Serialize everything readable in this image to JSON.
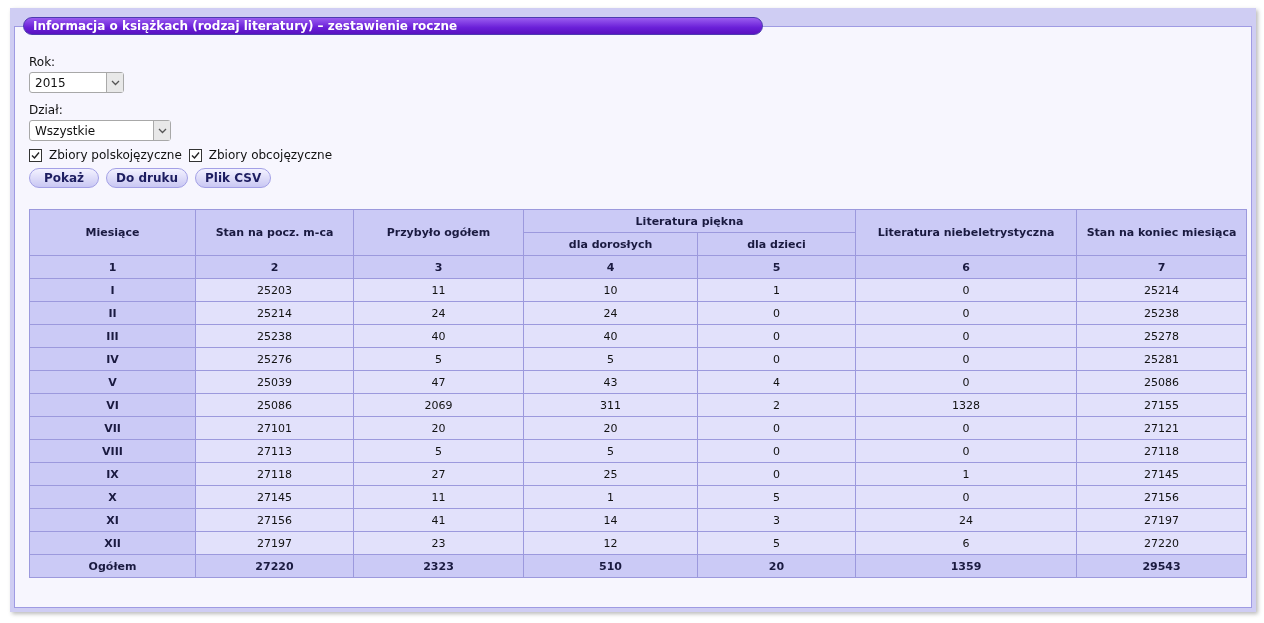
{
  "panel": {
    "title": "Informacja o książkach (rodzaj literatury) – zestawienie roczne"
  },
  "filters": {
    "year": {
      "label": "Rok:",
      "value": "2015"
    },
    "department": {
      "label": "Dział:",
      "value": "Wszystkie"
    }
  },
  "checkboxes": [
    {
      "label": "Zbiory polskojęzyczne",
      "checked": true
    },
    {
      "label": "Zbiory obcojęzyczne",
      "checked": true
    }
  ],
  "buttons": [
    "Pokaż",
    "Do druku",
    "Plik CSV"
  ],
  "table": {
    "columns": {
      "month": "Miesiące",
      "start": "Stan na pocz. m-ca",
      "added": "Przybyło ogółem",
      "fiction": "Literatura piękna",
      "adults": "dla dorosłych",
      "children": "dla dzieci",
      "nonfiction": "Literatura niebeletrystyczna",
      "end": "Stan na koniec miesiąca"
    },
    "column_numbers": [
      "1",
      "2",
      "3",
      "4",
      "5",
      "6",
      "7"
    ],
    "rows": [
      [
        "I",
        "25203",
        "11",
        "10",
        "1",
        "0",
        "25214"
      ],
      [
        "II",
        "25214",
        "24",
        "24",
        "0",
        "0",
        "25238"
      ],
      [
        "III",
        "25238",
        "40",
        "40",
        "0",
        "0",
        "25278"
      ],
      [
        "IV",
        "25276",
        "5",
        "5",
        "0",
        "0",
        "25281"
      ],
      [
        "V",
        "25039",
        "47",
        "43",
        "4",
        "0",
        "25086"
      ],
      [
        "VI",
        "25086",
        "2069",
        "311",
        "2",
        "1328",
        "27155"
      ],
      [
        "VII",
        "27101",
        "20",
        "20",
        "0",
        "0",
        "27121"
      ],
      [
        "VIII",
        "27113",
        "5",
        "5",
        "0",
        "0",
        "27118"
      ],
      [
        "IX",
        "27118",
        "27",
        "25",
        "0",
        "1",
        "27145"
      ],
      [
        "X",
        "27145",
        "11",
        "1",
        "5",
        "0",
        "27156"
      ],
      [
        "XI",
        "27156",
        "41",
        "14",
        "3",
        "24",
        "27197"
      ],
      [
        "XII",
        "27197",
        "23",
        "12",
        "5",
        "6",
        "27220"
      ]
    ],
    "total": [
      "Ogółem",
      "27220",
      "2323",
      "510",
      "20",
      "1359",
      "29543"
    ]
  }
}
